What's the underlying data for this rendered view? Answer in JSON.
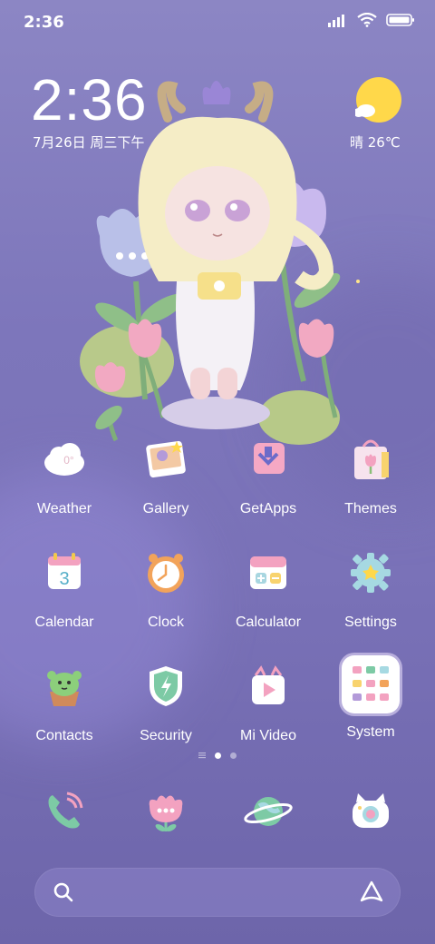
{
  "status_bar": {
    "time": "2:36"
  },
  "widget": {
    "clock": "2:36",
    "date": "7月26日 周三下午",
    "weather": "晴 26℃",
    "weather_icon": "sunny-icon"
  },
  "apps": [
    {
      "label": "Weather",
      "icon": "weather-icon"
    },
    {
      "label": "Gallery",
      "icon": "gallery-icon"
    },
    {
      "label": "GetApps",
      "icon": "getapps-icon"
    },
    {
      "label": "Themes",
      "icon": "themes-icon"
    },
    {
      "label": "Calendar",
      "icon": "calendar-icon"
    },
    {
      "label": "Clock",
      "icon": "clock-icon"
    },
    {
      "label": "Calculator",
      "icon": "calculator-icon"
    },
    {
      "label": "Settings",
      "icon": "settings-icon"
    },
    {
      "label": "Contacts",
      "icon": "contacts-icon"
    },
    {
      "label": "Security",
      "icon": "security-icon"
    },
    {
      "label": "Mi Video",
      "icon": "mivideo-icon"
    },
    {
      "label": "System",
      "icon": "folder-icon"
    }
  ],
  "weather_icon_text": "0°",
  "calendar_icon_text": "3",
  "dock": [
    {
      "icon": "phone-icon"
    },
    {
      "icon": "messages-icon"
    },
    {
      "icon": "browser-icon"
    },
    {
      "icon": "camera-icon"
    }
  ],
  "page_indicator": {
    "pages": 2,
    "current": 1
  },
  "colors": {
    "accent": "#7a72b8",
    "sun": "#ffd84a"
  }
}
